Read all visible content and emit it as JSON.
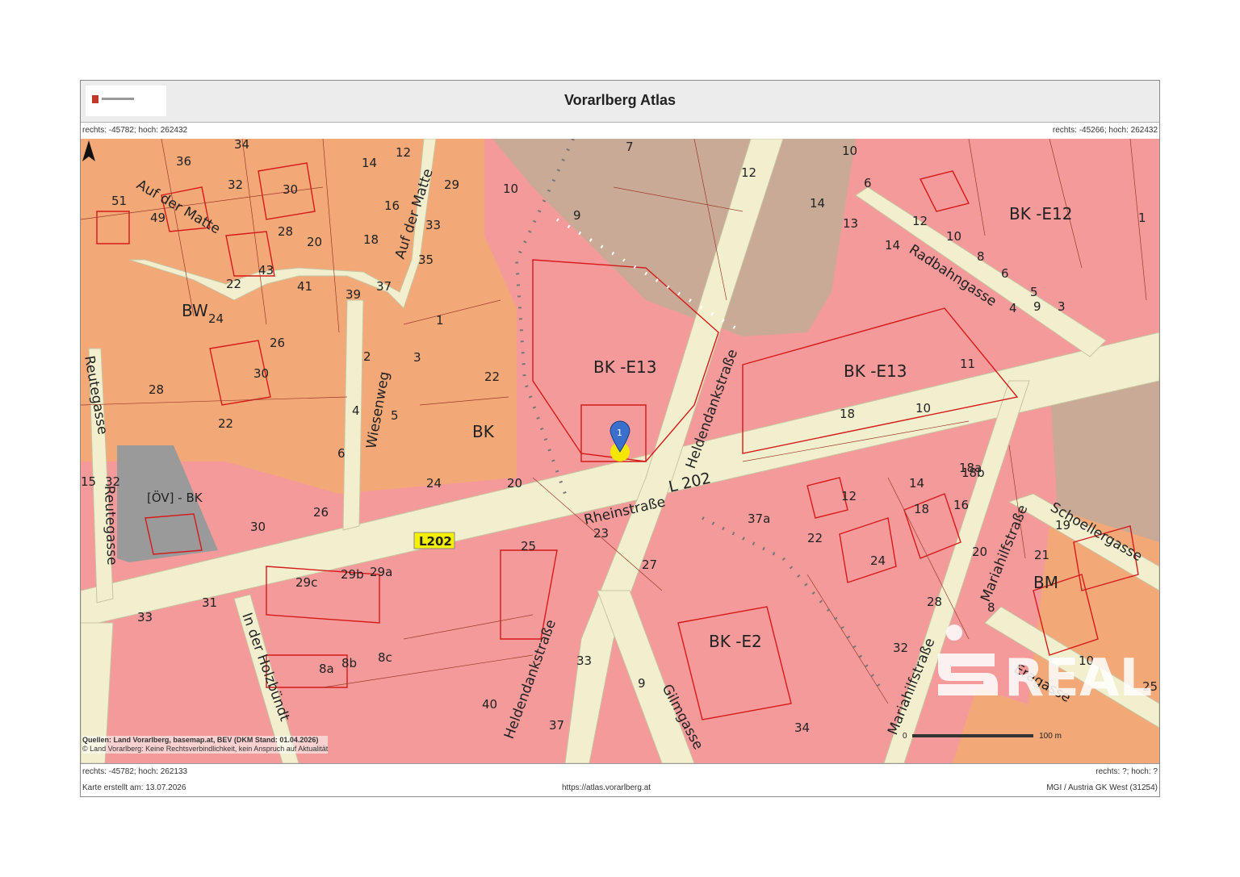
{
  "header": {
    "title": "Vorarlberg Atlas"
  },
  "coords": {
    "top_left": "rechts: -45782; hoch: 262432",
    "top_right": "rechts: -45266; hoch: 262432",
    "bottom_left": "rechts: -45782; hoch: 262133",
    "bottom_right": "rechts: ?; hoch: ?"
  },
  "footer": {
    "created": "Karte erstellt am: 13.07.2026",
    "url": "https://atlas.vorarlberg.at",
    "projection": "MGI / Austria GK West (31254)"
  },
  "credits": {
    "line1": "Quellen: Land Vorarlberg, basemap.at, BEV (DKM Stand: 01.04.2026)",
    "line2": "© Land Vorarlberg: Keine Rechtsverbindlichkeit, kein Anspruch auf Aktualität"
  },
  "scale": {
    "start": "0",
    "end": "100 m"
  },
  "marker": {
    "number": "1"
  },
  "road_badge": "L202",
  "streets": {
    "rheinstrasse": "Rheinstraße",
    "l202": "L 202",
    "heldendank1": "Heldendankstraße",
    "heldendank2": "Heldendankstraße",
    "radbahn": "Radbahngasse",
    "auf_der_matte1": "Auf der Matte",
    "auf_der_matte2": "Auf der Matte",
    "wiesenweg": "Wiesenweg",
    "reutegasse1": "Reutegasse",
    "reutegasse2": "Reutegasse",
    "holzbuendt": "In der Holzbündt",
    "gilmgasse": "Gilmgasse",
    "mariahilf1": "Mariahilfstraße",
    "mariahilf2": "Mariahilfstraße",
    "schoeller": "Schoellergasse",
    "eragasse": "Eragasse"
  },
  "zones": [
    "BK -E12",
    "BK -E13",
    "BK -E13",
    "BK -E2",
    "BK",
    "BW",
    "BM",
    "[ÖV] - BK"
  ],
  "house_numbers": [
    "36",
    "34",
    "32",
    "30",
    "51",
    "49",
    "28",
    "20",
    "18",
    "16",
    "14",
    "12",
    "10",
    "7",
    "12",
    "14",
    "10",
    "9",
    "29",
    "33",
    "35",
    "43",
    "41",
    "39",
    "37",
    "22",
    "24",
    "26",
    "30",
    "28",
    "22",
    "4",
    "6",
    "5",
    "2",
    "3",
    "1",
    "22",
    "20",
    "24",
    "26",
    "30",
    "32",
    "15",
    "23",
    "25",
    "27",
    "29c",
    "29b",
    "29a",
    "31",
    "33",
    "8a",
    "8b",
    "8c",
    "40",
    "37",
    "33",
    "9",
    "34",
    "22",
    "24",
    "28",
    "32",
    "20",
    "18",
    "18a",
    "18b",
    "16",
    "14",
    "12",
    "10",
    "18",
    "11",
    "13",
    "14",
    "12",
    "10",
    "8",
    "6",
    "5",
    "4",
    "3",
    "9",
    "6",
    "1",
    "19",
    "21",
    "8",
    "10",
    "25",
    "37a"
  ],
  "colors": {
    "residential_orange": "#f3a878",
    "commercial_red": "#f49a9a",
    "brown": "#c8aa96",
    "road": "#f2efcf",
    "grey": "#9a9a9a",
    "marker_blue": "#3a6fcc",
    "marker_yellow": "#f5e600"
  }
}
